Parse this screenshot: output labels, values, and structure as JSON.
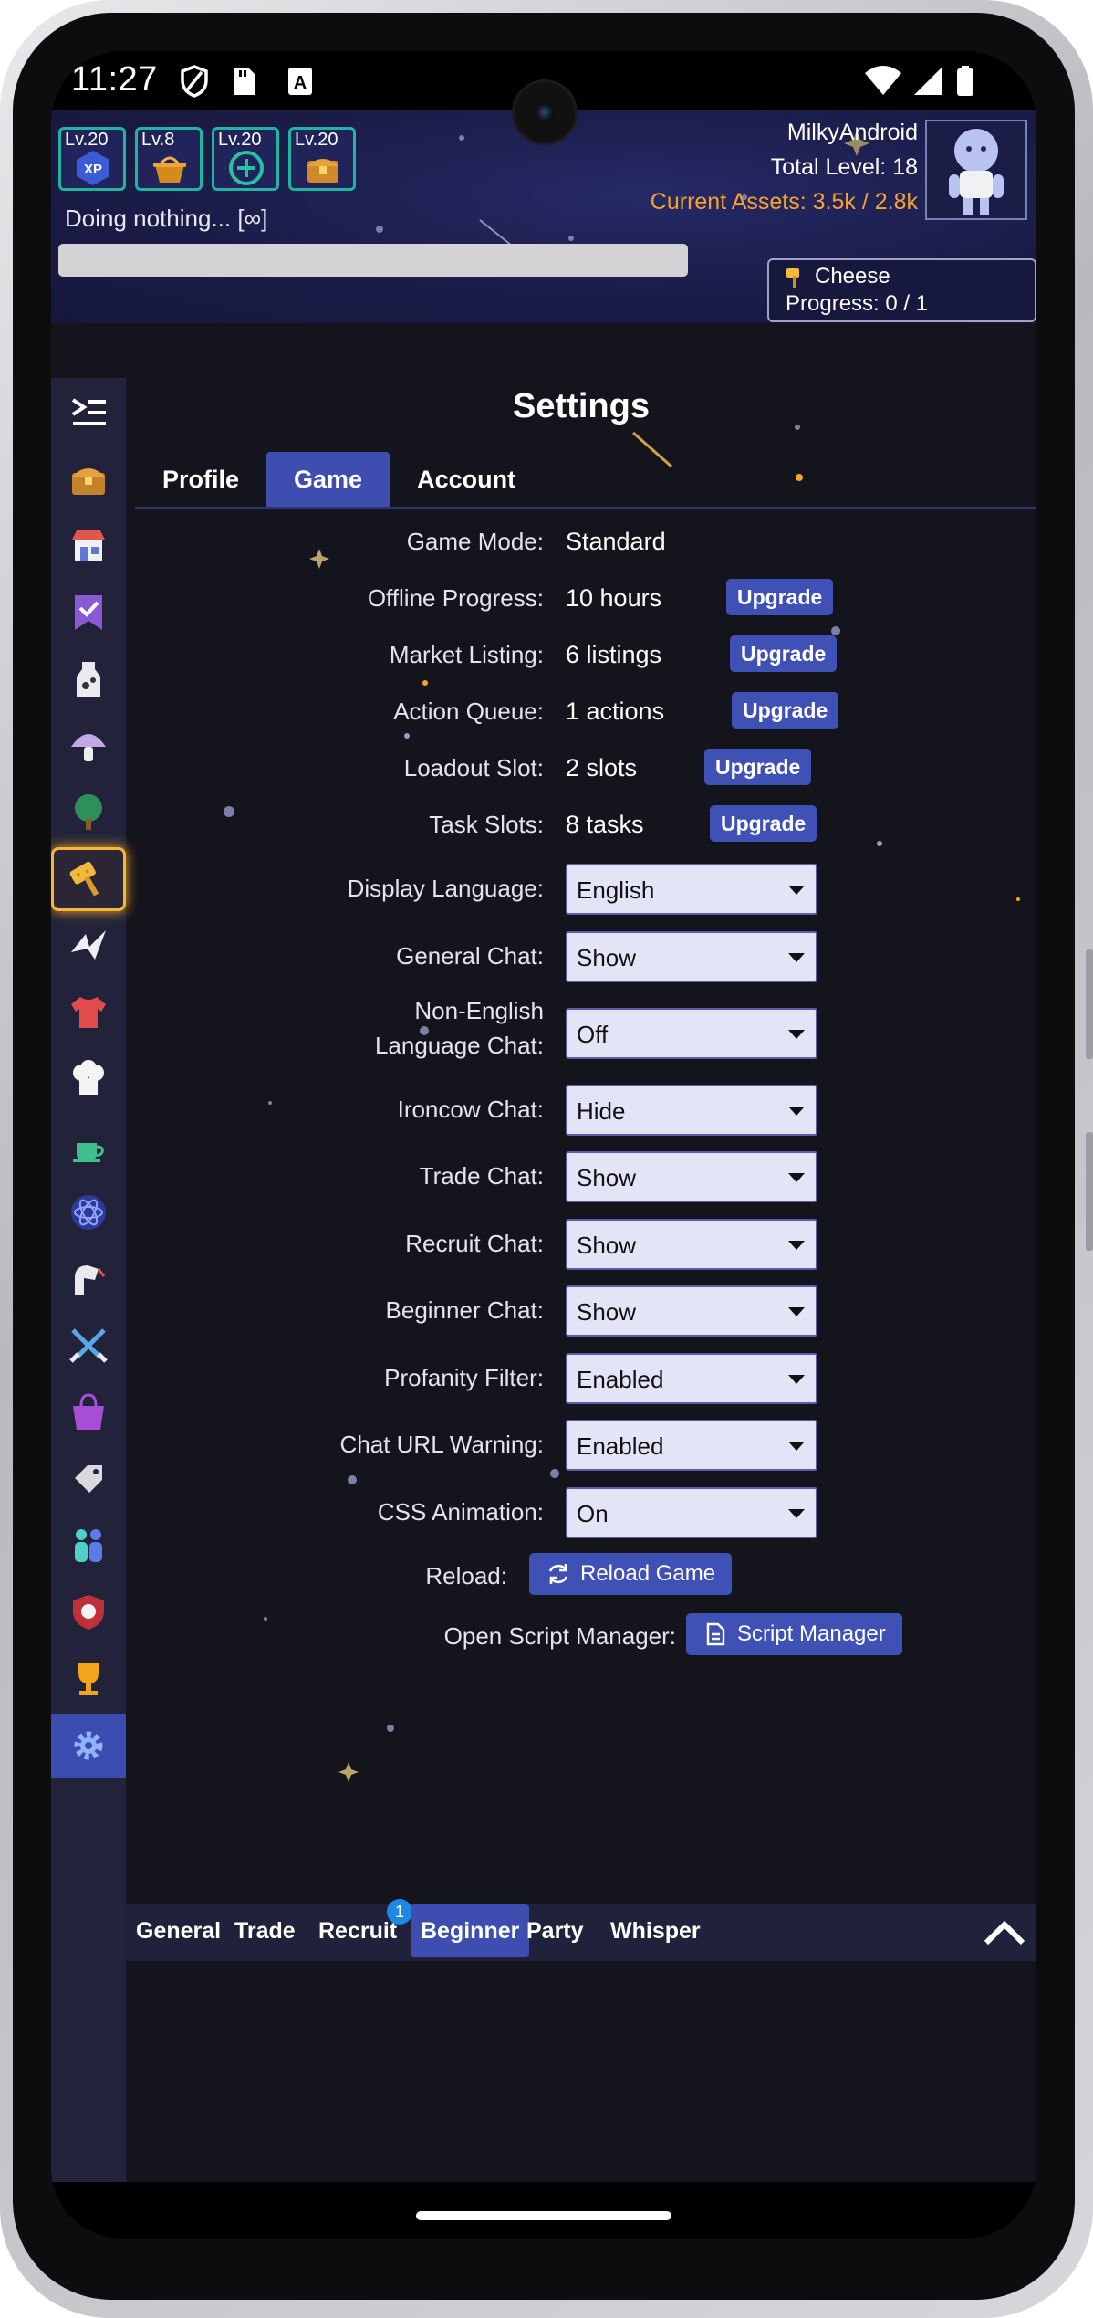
{
  "status_bar": {
    "time": "11:27"
  },
  "header": {
    "skills": [
      {
        "level": "Lv.20",
        "icon": "xp-icon"
      },
      {
        "level": "Lv.8",
        "icon": "basket-icon"
      },
      {
        "level": "Lv.20",
        "icon": "refresh-plus-icon"
      },
      {
        "level": "Lv.20",
        "icon": "treasure-chest-icon"
      }
    ],
    "activity": "Doing nothing... [∞]",
    "player_name": "MilkyAndroid",
    "total_level": "Total Level: 18",
    "assets": "Current Assets: 3.5k / 2.8k",
    "task_item": "Cheese",
    "task_progress": "Progress: 0 / 1",
    "colors": {
      "assets": "#f7a12f",
      "badge_border": "#1fb5a0"
    }
  },
  "sidebar": {
    "items": [
      {
        "icon": "collapse-menu-icon"
      },
      {
        "icon": "chest-icon"
      },
      {
        "icon": "marketplace-icon"
      },
      {
        "icon": "tasks-icon"
      },
      {
        "icon": "milking-icon"
      },
      {
        "icon": "foraging-icon"
      },
      {
        "icon": "woodcutting-icon"
      },
      {
        "icon": "cheesesmithing-icon"
      },
      {
        "icon": "crafting-icon"
      },
      {
        "icon": "tailoring-icon"
      },
      {
        "icon": "cooking-icon"
      },
      {
        "icon": "brewing-icon"
      },
      {
        "icon": "alchemy-icon"
      },
      {
        "icon": "enhancing-icon"
      },
      {
        "icon": "combat-icon"
      },
      {
        "icon": "shop-icon"
      },
      {
        "icon": "cowbell-store-icon"
      },
      {
        "icon": "social-icon"
      },
      {
        "icon": "guild-icon"
      },
      {
        "icon": "leaderboard-icon"
      },
      {
        "icon": "settings-icon"
      }
    ]
  },
  "settings": {
    "title": "Settings",
    "tabs": [
      "Profile",
      "Game",
      "Account"
    ],
    "active_tab": "Game",
    "game_mode": {
      "label": "Game Mode:",
      "value": "Standard"
    },
    "offline_progress": {
      "label": "Offline Progress:",
      "value": "10 hours",
      "button": "Upgrade"
    },
    "market_listing": {
      "label": "Market Listing:",
      "value": "6 listings",
      "button": "Upgrade"
    },
    "action_queue": {
      "label": "Action Queue:",
      "value": "1 actions",
      "button": "Upgrade"
    },
    "loadout_slot": {
      "label": "Loadout Slot:",
      "value": "2 slots",
      "button": "Upgrade"
    },
    "task_slots": {
      "label": "Task Slots:",
      "value": "8 tasks",
      "button": "Upgrade"
    },
    "display_language": {
      "label": "Display Language:",
      "value": "English"
    },
    "general_chat": {
      "label": "General Chat:",
      "value": "Show"
    },
    "non_english_chat": {
      "label_line1": "Non-English",
      "label_line2": "Language Chat:",
      "value": "Off"
    },
    "ironcow_chat": {
      "label": "Ironcow Chat:",
      "value": "Hide"
    },
    "trade_chat": {
      "label": "Trade Chat:",
      "value": "Show"
    },
    "recruit_chat": {
      "label": "Recruit Chat:",
      "value": "Show"
    },
    "beginner_chat": {
      "label": "Beginner Chat:",
      "value": "Show"
    },
    "profanity_filter": {
      "label": "Profanity Filter:",
      "value": "Enabled"
    },
    "chat_url_warning": {
      "label": "Chat URL Warning:",
      "value": "Enabled"
    },
    "css_animation": {
      "label": "CSS Animation:",
      "value": "On"
    },
    "reload": {
      "label": "Reload:",
      "button": "Reload Game"
    },
    "script_manager": {
      "label": "Open Script Manager:",
      "button": "Script Manager"
    }
  },
  "chat": {
    "tabs": [
      "General",
      "Trade",
      "Recruit",
      "Beginner",
      "Party",
      "Whisper"
    ],
    "active_tab": "Beginner",
    "recruit_badge": "1"
  }
}
